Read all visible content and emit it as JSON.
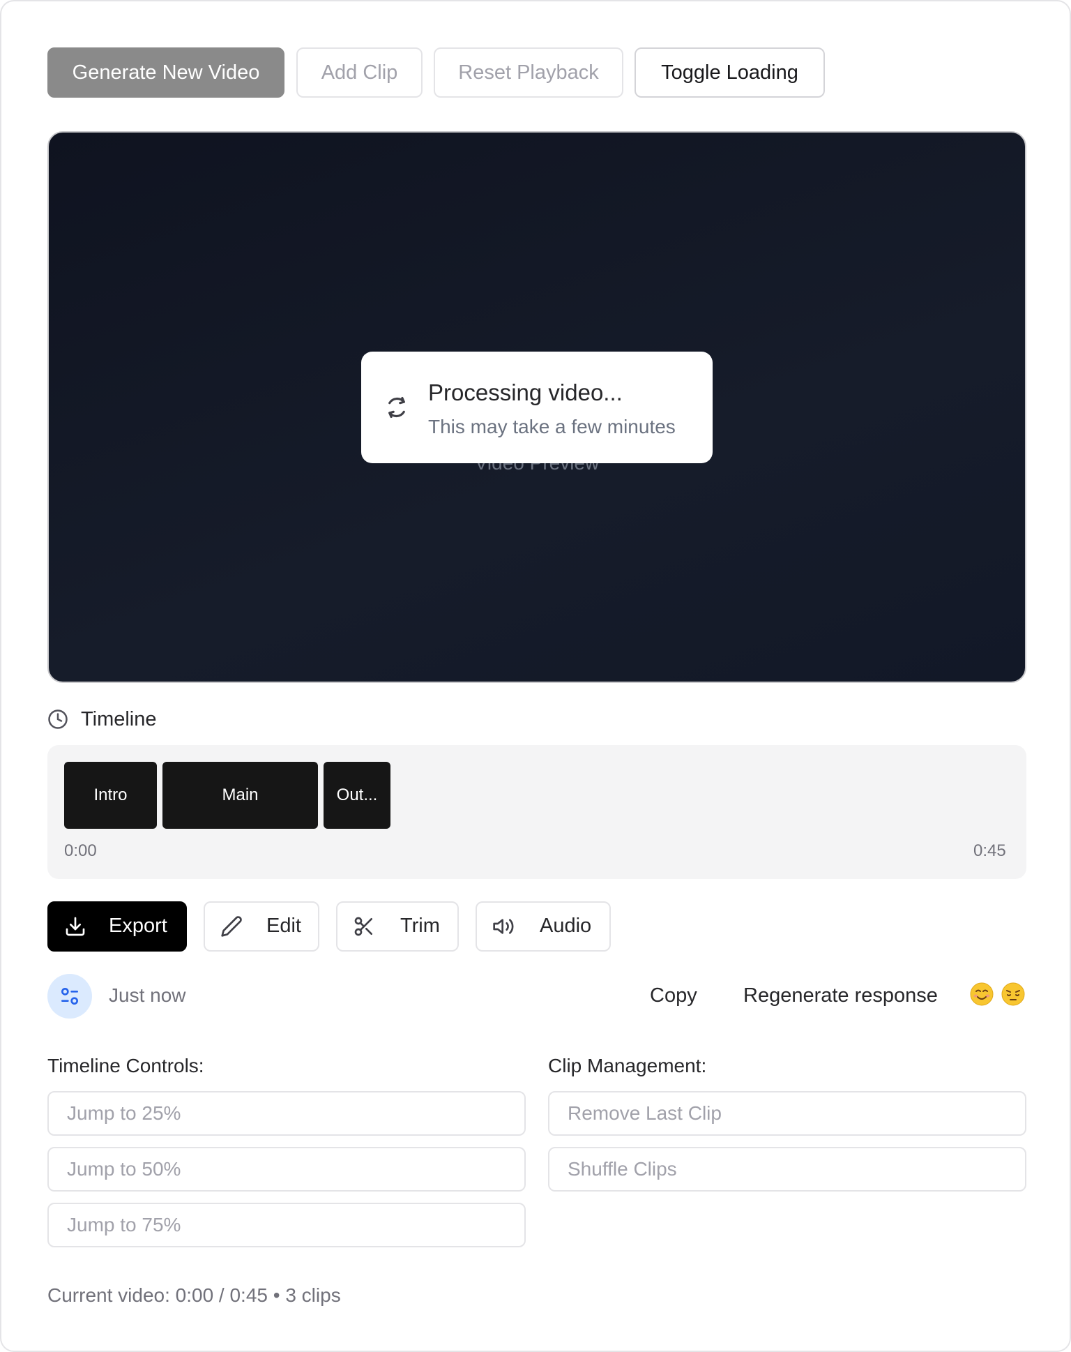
{
  "toolbar": {
    "generate_label": "Generate New Video",
    "add_clip_label": "Add Clip",
    "reset_label": "Reset Playback",
    "toggle_loading_label": "Toggle Loading"
  },
  "video": {
    "preview_label": "Video Preview",
    "loading_title": "Processing video...",
    "loading_subtitle": "This may take a few minutes"
  },
  "timeline": {
    "heading": "Timeline",
    "clips": [
      {
        "label": "Intro"
      },
      {
        "label": "Main"
      },
      {
        "label": "Out..."
      }
    ],
    "start_time": "0:00",
    "end_time": "0:45"
  },
  "actions": {
    "export_label": "Export",
    "edit_label": "Edit",
    "trim_label": "Trim",
    "audio_label": "Audio"
  },
  "response": {
    "timestamp": "Just now",
    "copy_label": "Copy",
    "regenerate_label": "Regenerate response",
    "emojis": [
      "😊",
      "😔"
    ]
  },
  "timeline_controls": {
    "title": "Timeline Controls:",
    "items": [
      "Jump to 25%",
      "Jump to 50%",
      "Jump to 75%"
    ]
  },
  "clip_management": {
    "title": "Clip Management:",
    "items": [
      "Remove Last Clip",
      "Shuffle Clips"
    ]
  },
  "footer": {
    "status": "Current video: 0:00 / 0:45 • 3 clips"
  },
  "colors": {
    "primary_disabled": "#8a8a8a",
    "video_bg": "#111827",
    "export_bg": "#000000",
    "avatar_bg": "#dbeafe",
    "avatar_icon": "#2563eb"
  }
}
